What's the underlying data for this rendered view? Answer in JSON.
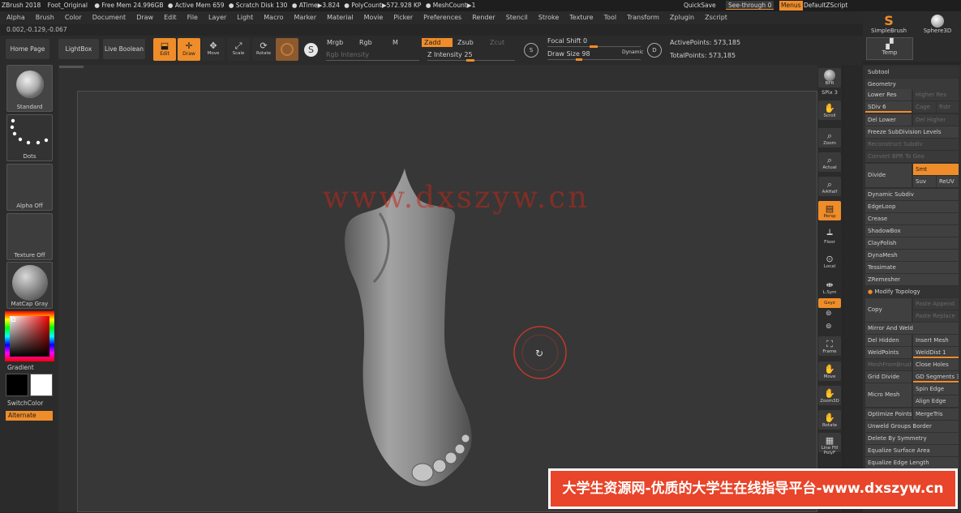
{
  "titlebar": {
    "app": "ZBrush 2018",
    "file": "Foot_Original",
    "free_mem": "● Free Mem 24.996GB",
    "active_mem": "● Active Mem 659",
    "scratch": "● Scratch Disk 130",
    "atime": "● ATime▶3.824",
    "polycount": "● PolyCount▶572.928 KP",
    "meshcount": "● MeshCount▶1",
    "quicksave": "QuickSave",
    "see_through_label": "See-through",
    "see_through_value": "0",
    "menus": "Menus",
    "script": "DefaultZScript"
  },
  "menu": [
    "Alpha",
    "Brush",
    "Color",
    "Document",
    "Draw",
    "Edit",
    "File",
    "Layer",
    "Light",
    "Macro",
    "Marker",
    "Material",
    "Movie",
    "Picker",
    "Preferences",
    "Render",
    "Stencil",
    "Stroke",
    "Texture",
    "Tool",
    "Transform",
    "Zplugin",
    "Zscript"
  ],
  "coords": "0.002,-0.129,-0.067",
  "shelf": {
    "home": "Home Page",
    "lightbox": "LightBox",
    "live_boolean": "Live Boolean",
    "edit": "Edit",
    "draw": "Draw",
    "move": "Move",
    "scale": "Scale",
    "rotate": "Rotate",
    "mrgb": "Mrgb",
    "rgb": "Rgb",
    "m": "M",
    "zadd": "Zadd",
    "zsub": "Zsub",
    "zcut": "Zcut",
    "rgb_intensity": "Rgb Intensity",
    "z_intensity_label": "Z Intensity",
    "z_intensity_value": "25",
    "focal_shift_label": "Focal Shift",
    "focal_shift_value": "0",
    "draw_size_label": "Draw Size",
    "draw_size_value": "98",
    "dynamic": "Dynamic",
    "active_points": "ActivePoints: 573,185",
    "total_points": "TotalPoints: 573,185"
  },
  "left": {
    "brush": "Standard",
    "stroke": "Dots",
    "alpha": "Alpha Off",
    "texture": "Texture Off",
    "material": "MatCap Gray",
    "gradient": "Gradient",
    "switch_color": "SwitchColor",
    "alternate": "Alternate"
  },
  "right_shelf": [
    "BPR",
    "SPix 3",
    "Scroll",
    "Zoom",
    "Actual",
    "AAHalf",
    "Persp",
    "Floor",
    "Local",
    "L.Sym",
    "Gxyz",
    "Frame",
    "Move",
    "Zoom3D",
    "Rotate",
    "Line Fill PolyF"
  ],
  "brushes": {
    "simple": "SimpleBrush",
    "sphere": "Sphere3D",
    "temp": "Temp"
  },
  "panel": {
    "subtool": "Subtool",
    "geometry": "Geometry",
    "lower_res": "Lower Res",
    "higher_res": "Higher Res",
    "sdiv": "SDiv 6",
    "cage": "Cage",
    "rstr": "Rstr",
    "del_lower": "Del Lower",
    "del_higher": "Del Higher",
    "freeze": "Freeze SubDivision Levels",
    "reconstruct": "Reconstruct Subdiv",
    "convert_bpr": "Convert BPR To Geo",
    "divide": "Divide",
    "smt": "Smt",
    "suv": "Suv",
    "reuv": "ReUV",
    "dynamic_subdiv": "Dynamic Subdiv",
    "edgeloop": "EdgeLoop",
    "crease": "Crease",
    "shadowbox": "ShadowBox",
    "claypolish": "ClayPolish",
    "dynamesh": "DynaMesh",
    "tessimate": "Tessimate",
    "zremesher": "ZRemesher",
    "modify_topology": "Modify Topology",
    "copy": "Copy",
    "paste_append": "Paste Append",
    "paste_replace": "Paste Replace",
    "mirror_weld": "Mirror And Weld",
    "del_hidden": "Del Hidden",
    "insert_mesh": "Insert Mesh",
    "weld_points": "WeldPoints",
    "weld_dist": "WeldDist 1",
    "mesh_from_brush": "MeshFromBrush",
    "close_holes": "Close Holes",
    "grid_divide": "Grid Divide",
    "gd_segments": "GD Segments 3",
    "spin_edge": "Spin Edge",
    "micro_mesh": "Micro Mesh",
    "align_edge": "Align Edge",
    "optimize_points": "Optimize Points",
    "merge_tris": "MergeTris",
    "unweld_groups": "Unweld Groups Border",
    "delete_symmetry": "Delete By Symmetry",
    "eq_surface": "Equalize Surface Area",
    "eq_edge": "Equalize Edge Length"
  },
  "watermark": "www.dxszyw.cn",
  "banner": "大学生资源网-优质的大学生在线指导平台-www.dxszyw.cn"
}
